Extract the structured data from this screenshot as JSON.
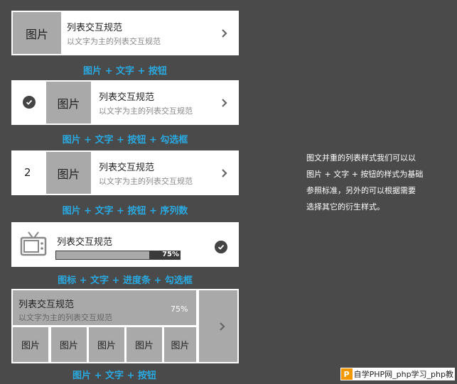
{
  "placeholder_image": "图片",
  "item_title": "列表交互规范",
  "item_subtitle": "以文字为主的列表交互规范",
  "cards": {
    "card1_caption": "图片 + 文字 + 按钮",
    "card2_caption": "图片 + 文字 + 按钮 + 勾选框",
    "card3_caption": "图片 + 文字 + 按钮 + 序列数",
    "card3_index": "2",
    "card4_caption": "图标 + 文字 + 进度条 + 勾选框",
    "card4_progress": "75%",
    "card4_progress_value": 0.75,
    "card5_caption": "图片 + 文字 + 按钮",
    "card5_progress": "75%",
    "card5_grid": [
      "图片",
      "图片",
      "图片",
      "图片",
      "图片"
    ]
  },
  "description": [
    "图文并重的列表样式我们可以以",
    "图片 + 文字 + 按钮的样式为基础",
    "参照标准，另外的可以根据需要",
    "选择其它的衍生样式。"
  ],
  "watermark": {
    "logo": "P",
    "text": "自学PHP网_php学习_php教"
  },
  "colors": {
    "background": "#4a4a4a",
    "accent": "#2aa9e0",
    "placeholder": "#a9a9a9"
  }
}
